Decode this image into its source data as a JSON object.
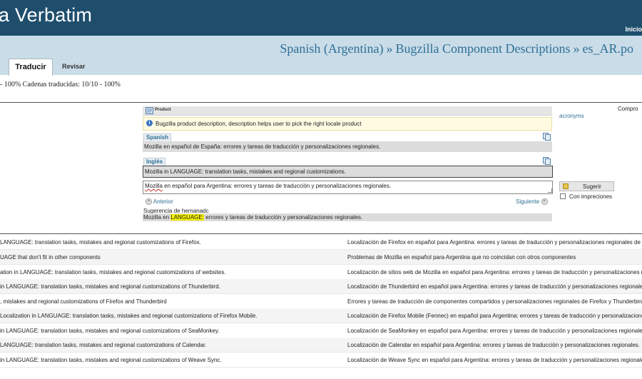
{
  "header": {
    "brand": "a Verbatim",
    "nav_link": "Inicio"
  },
  "breadcrumb": {
    "language": "Spanish (Argentina)",
    "sep1": "»",
    "project": "Bugzilla Component Descriptions",
    "sep2": "»",
    "file": "es_AR.po"
  },
  "tabs": [
    {
      "label": "Traducir",
      "active": true
    },
    {
      "label": "Revisar",
      "active": false
    }
  ],
  "stats": {
    "text": "- 100%    Cadenas traducidas: 10/10 - 100%"
  },
  "editor": {
    "product_label": "Product",
    "description": "Bugzilla product description, description helps user to pick the right locale product",
    "spanish_tag": "Spanish",
    "spanish_text": "Mozilla en español de España: errores y tareas de traducción y personalizaciones regionales.",
    "ingles_tag": "Inglés",
    "source_text": "Mozilla in LANGUAGE: translation tasks, mistakes and regional customizations.",
    "target_word": "Mozilla",
    "target_rest": " en español para Argentina: errores y tareas de traducción y personalizaciones regionales.",
    "prev_label": "Anterior",
    "next_label": "Siguiente",
    "suggestion_label": "Sugerencia de hernanadc",
    "suggestion_pre": "Mozilla en ",
    "suggestion_highlight": "LANGUAGE:",
    "suggestion_post": " errores y tareas de traducción y personalizaciones regionales."
  },
  "side": {
    "acronyms": "acronyms",
    "title": "Compro",
    "suggest_button": "Sugerir",
    "with_issues": "Con impreciones"
  },
  "units": [
    {
      "source": "LANGUAGE: translation tasks, mistakes and regional customizations of Firefox.",
      "target": "Localización de Firefox en español para Argentina: errores y tareas de traducción y personalizaciones regionales de Firefox."
    },
    {
      "source": "UAGE that don't fit in other components",
      "target": "Problemas de Mozilla en español para Argentina que no coincidan con otros componentes"
    },
    {
      "source": "ation in LANGUAGE: translation tasks, mistakes and regional customizations of websites.",
      "target": "Localización de sitios web de Mozilla en español para Argentina: errores y tareas de traducción y personalizaciones regionales."
    },
    {
      "source": "in LANGUAGE: translation tasks, mistakes and regional customizations of Thunderbird.",
      "target": "Localización de Thunderbird en español para Argentina: errores y tareas de traducción y personalizaciones regionales."
    },
    {
      "source": ", mistakes and regional customizations of Firefox and Thunderbird",
      "target": "Errores y tareas de traducción de componentes compartidos y personalizaciones regionales de Firefox y Thunderbird"
    },
    {
      "source": "Localization in LANGUAGE: translation tasks, mistakes and regional customizations of Firefox Mobile.",
      "target": "Localización de Firefox Mobile (Fennec) en español para Argentina: errores y tareas de traducción y personalizaciones."
    },
    {
      "source": "in LANGUAGE: translation tasks, mistakes and regional customizations of SeaMonkey.",
      "target": "Localización de SeaMonkey en español para Argentina: errores y tareas de traducción y personalizaciones regionales."
    },
    {
      "source": "LANGUAGE: translation tasks, mistakes and regional customizations of Calendar.",
      "target": "Localización de Calendar en español para Argentina: errores y tareas de traducción y personalizaciones regionales."
    },
    {
      "source": "in LANGUAGE: translation tasks, mistakes and regional customizations of Weave Sync.",
      "target": "Localización de Weave Sync en español para Argentina: errores y tareas de traducción y personalizaciones regionales."
    }
  ],
  "colors": {
    "header_bg": "#1f4e6d",
    "title_band_bg": "#c9dce8",
    "link": "#2f6f95",
    "highlight": "#f5f000"
  }
}
